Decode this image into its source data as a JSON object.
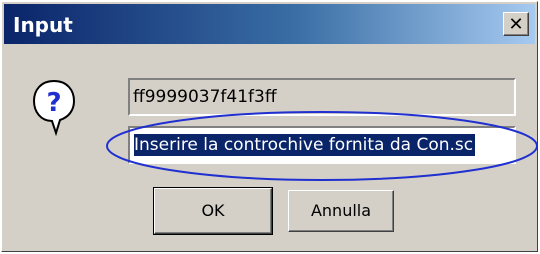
{
  "window": {
    "title": "Input",
    "close_symbol": "✕"
  },
  "dialog": {
    "icon": "question-icon",
    "icon_glyph": "?",
    "text_field_value": "ff9999037f41f3ff",
    "input_selected_text": "Inserire la controchive fornita da Con.sc"
  },
  "buttons": {
    "ok_label": "OK",
    "cancel_label": "Annulla"
  },
  "colors": {
    "titlebar_start": "#0a246a",
    "titlebar_end": "#a6caf0",
    "selection": "#0a246a",
    "highlight_ellipse": "#1f2fd0"
  }
}
